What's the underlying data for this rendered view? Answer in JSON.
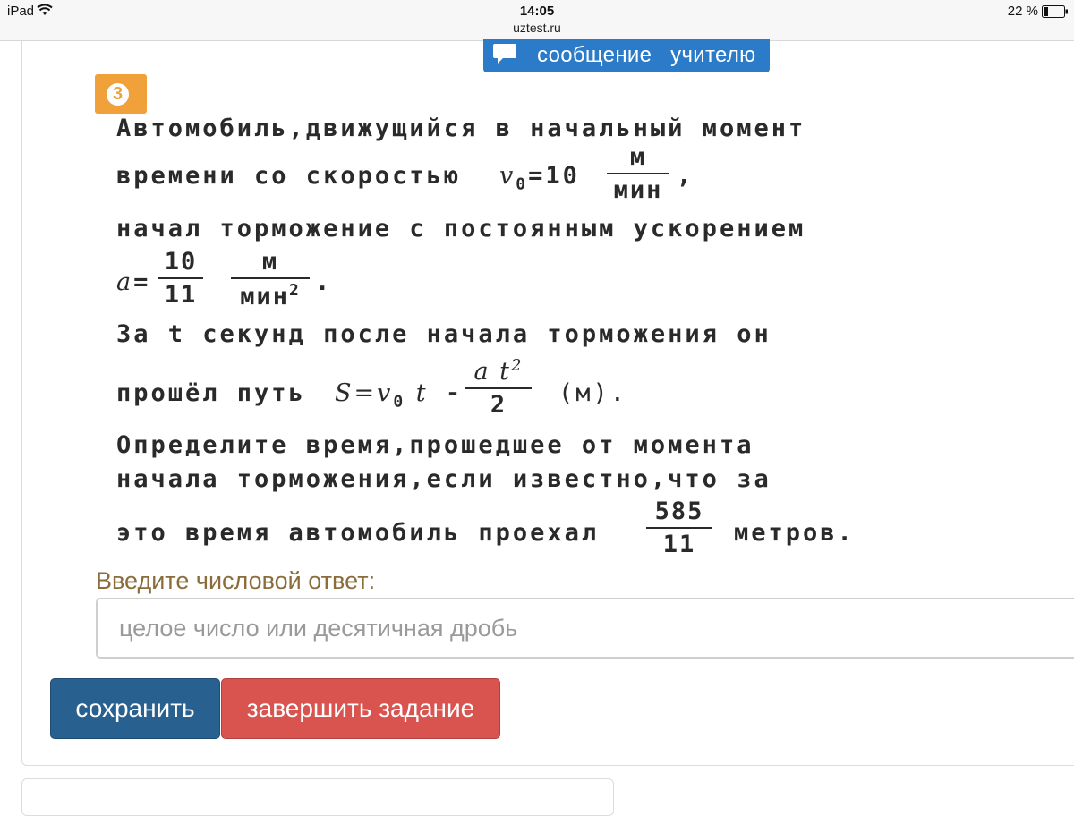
{
  "status_bar": {
    "device": "iPad",
    "time": "14:05",
    "url": "uztest.ru",
    "battery": "22 %"
  },
  "header": {
    "message_button": "сообщение   учителю"
  },
  "question": {
    "number": "3",
    "lines": {
      "l1": "Автомобиль,движущийся в начальный момент",
      "l2_pre": "времени со скоростью ",
      "v0_var": "v",
      "v0_sub": "0",
      "v0_eq": "=10",
      "v0_unit_num": "м",
      "v0_unit_den": "мин",
      "l2_post": ",",
      "l3": "начал торможение с постоянным ускорением",
      "a_var": "a",
      "a_eq": "=",
      "a_num": "10",
      "a_den": "11",
      "a_unit_num": "м",
      "a_unit_den": "мин",
      "a_unit_den_sup": "2",
      "a_post": ".",
      "l5": "За t секунд после начала торможения он",
      "l6_pre": "прошёл путь ",
      "s_formula": "S=v",
      "s_sub": "0",
      "s_t": " t",
      "s_minus": " -",
      "s_num": "a t",
      "s_num_sup": "2",
      "s_den": "2",
      "s_unit": "(м).",
      "l7": "Определите время,прошедшее от момента",
      "l8": "начала торможения,если известно,что за",
      "l9_pre": "это время автомобиль проехал",
      "dist_num": "585",
      "dist_den": "11",
      "l9_post": "метров."
    }
  },
  "answer": {
    "label": "Введите числовой ответ:",
    "placeholder": "целое число или десятичная дробь",
    "value": ""
  },
  "buttons": {
    "save": "сохранить",
    "finish": "завершить задание"
  },
  "colors": {
    "save_button": "#286090",
    "finish_button": "#d9534f",
    "message_button": "#2b7bc8",
    "question_badge": "#f0a13a",
    "answer_label": "#8a6d3b"
  }
}
